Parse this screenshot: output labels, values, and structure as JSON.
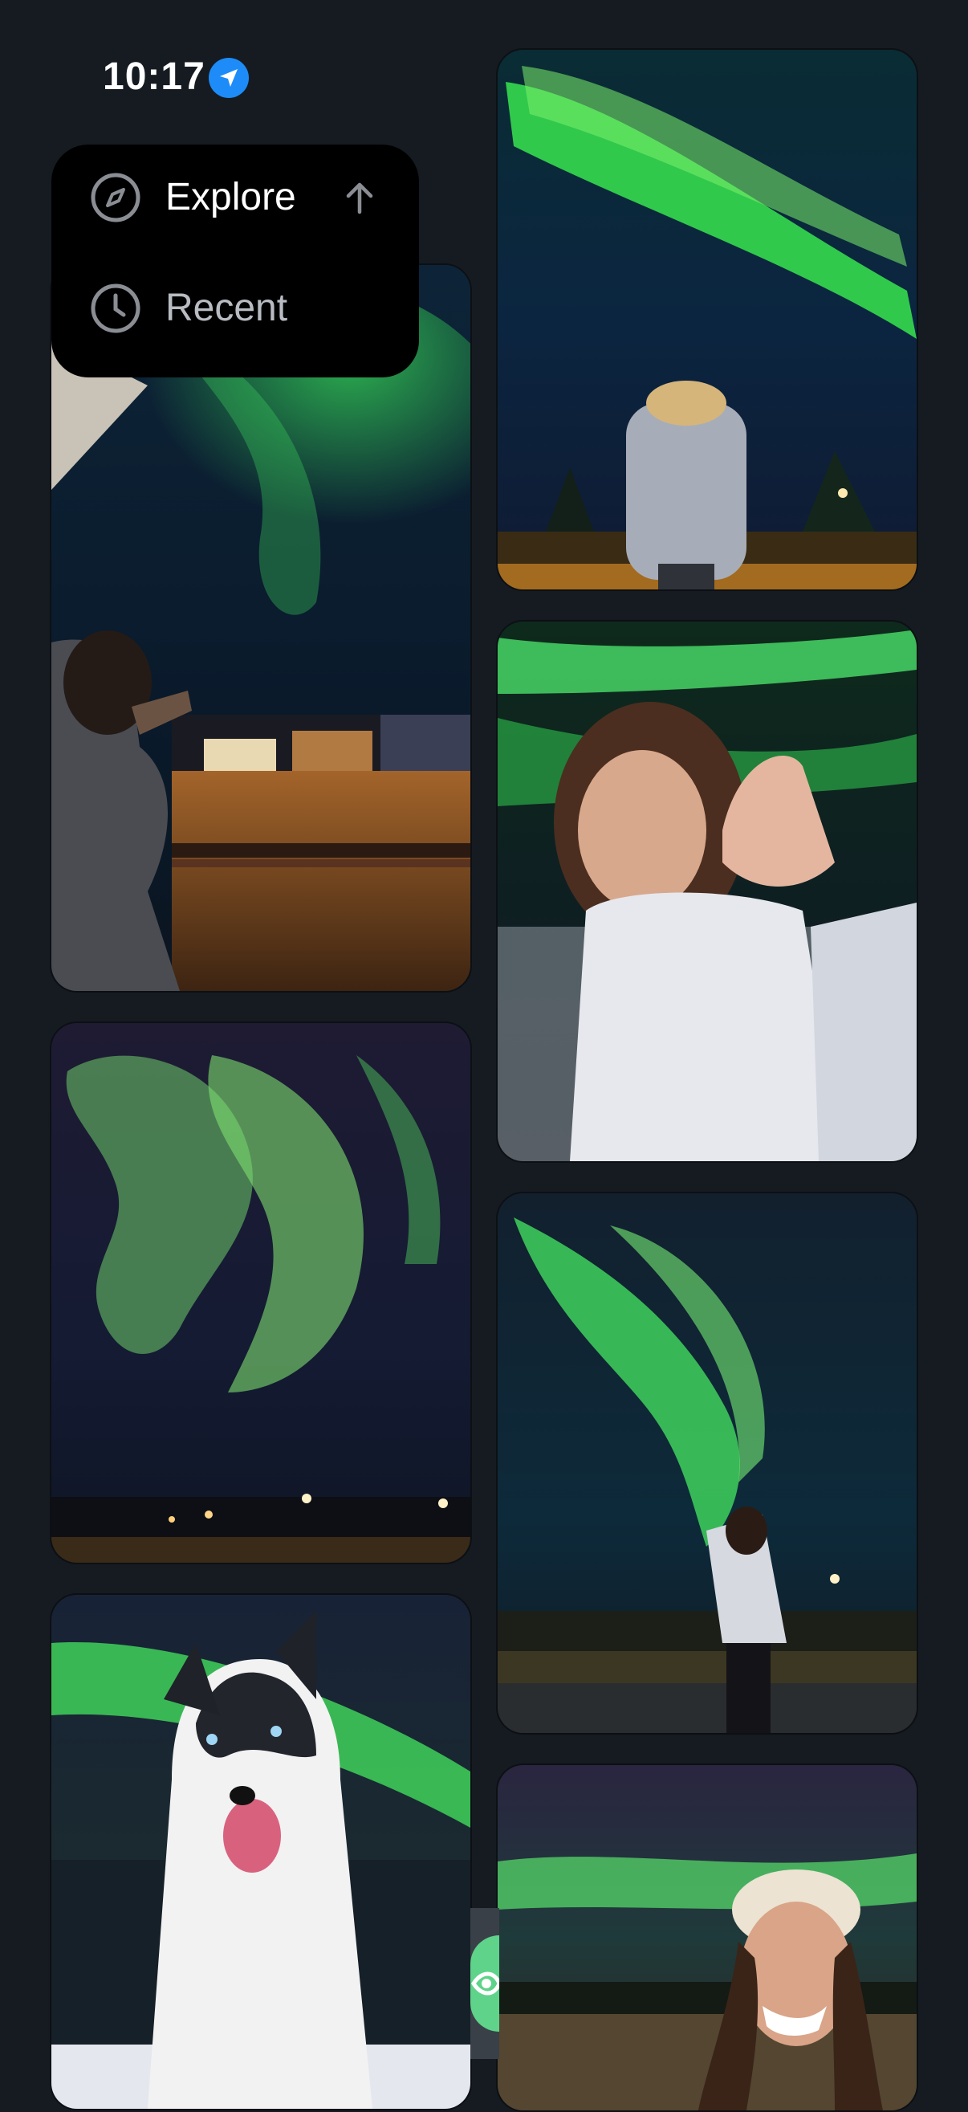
{
  "status_bar": {
    "time": "10:17",
    "location_icon": "location-arrow-icon"
  },
  "menu": {
    "items": [
      {
        "label": "Explore",
        "icon": "compass-icon",
        "trailing_icon": "arrow-up-icon",
        "selected": true
      },
      {
        "label": "Recent",
        "icon": "clock-icon",
        "selected": false
      }
    ]
  },
  "photos": [
    {
      "description_icon": "photo-aurora-balcony-drink"
    },
    {
      "description_icon": "photo-aurora-man-back"
    },
    {
      "description_icon": "photo-aurora-woman-ring"
    },
    {
      "description_icon": "photo-aurora-streetlights"
    },
    {
      "description_icon": "photo-aurora-woman-road"
    },
    {
      "description_icon": "photo-husky-aurora"
    },
    {
      "description_icon": "photo-aurora-woman-beanie"
    }
  ],
  "colors": {
    "background": "#161b22",
    "menu": "#000000",
    "accent": "#1d8cf8",
    "aurora": "#39d353"
  }
}
